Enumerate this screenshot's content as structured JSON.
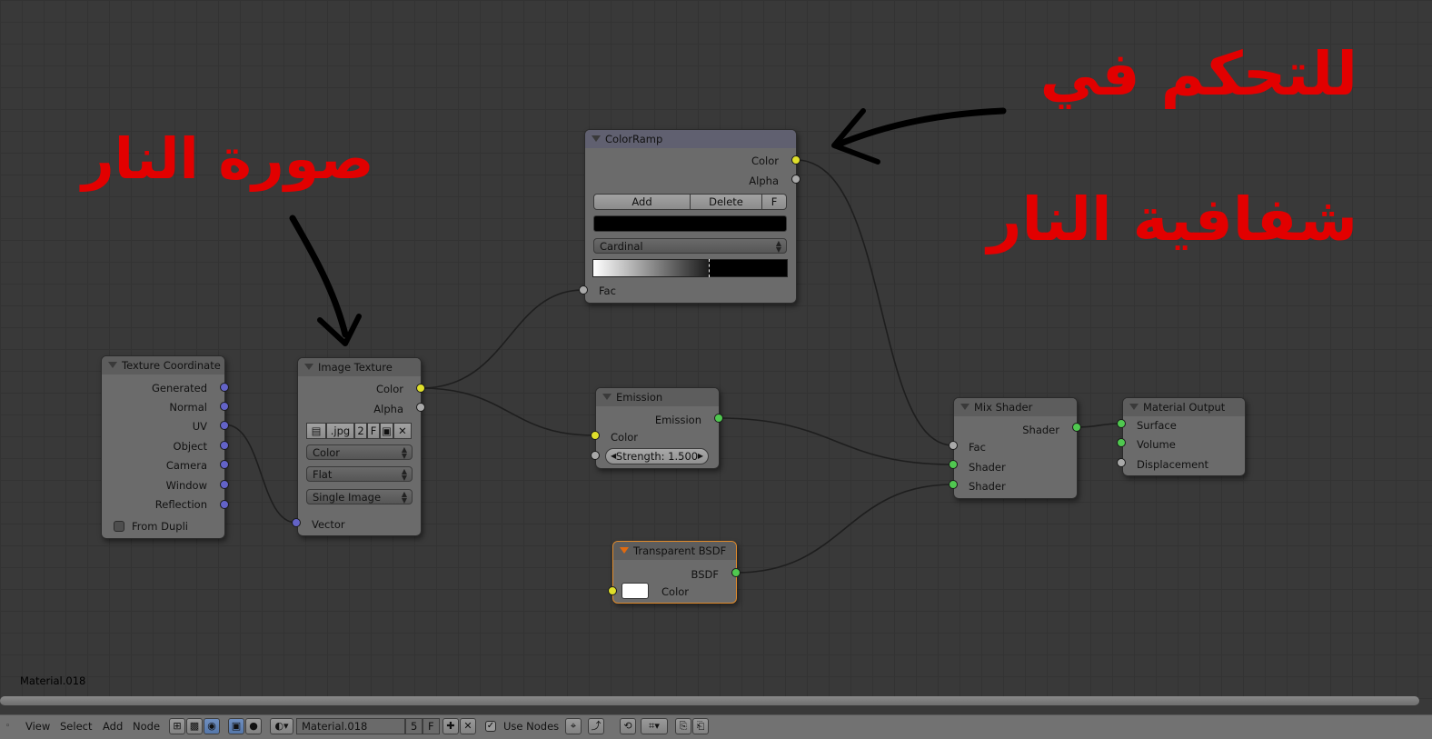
{
  "annotations": {
    "top_right_line1": "للتحكم في",
    "top_right_line2": "شفافية النار",
    "left": "صورة النار"
  },
  "footer_material_label": "Material.018",
  "nodes": {
    "texture_coordinate": {
      "title": "Texture Coordinate",
      "outputs": [
        "Generated",
        "Normal",
        "UV",
        "Object",
        "Camera",
        "Window",
        "Reflection"
      ],
      "checkbox_label": "From Dupli"
    },
    "image_texture": {
      "title": "Image Texture",
      "outputs": [
        "Color",
        "Alpha"
      ],
      "image_name": ".jpg",
      "users_count": "2",
      "fake_user": "F",
      "color_space": "Color",
      "projection": "Flat",
      "source": "Single Image",
      "input": "Vector"
    },
    "color_ramp": {
      "title": "ColorRamp",
      "outputs": [
        "Color",
        "Alpha"
      ],
      "add_label": "Add",
      "delete_label": "Delete",
      "f_label": "F",
      "interpolation": "Cardinal",
      "input": "Fac"
    },
    "emission": {
      "title": "Emission",
      "output": "Emission",
      "input_color": "Color",
      "strength": "Strength: 1.500"
    },
    "transparent_bsdf": {
      "title": "Transparent BSDF",
      "output": "BSDF",
      "input_color": "Color"
    },
    "mix_shader": {
      "title": "Mix Shader",
      "output": "Shader",
      "inputs": [
        "Fac",
        "Shader",
        "Shader"
      ]
    },
    "material_output": {
      "title": "Material Output",
      "inputs": [
        "Surface",
        "Volume",
        "Displacement"
      ]
    }
  },
  "toolbar": {
    "menu": [
      "View",
      "Select",
      "Add",
      "Node"
    ],
    "material_name": "Material.018",
    "users": "5",
    "fake_user": "F",
    "use_nodes_label": "Use Nodes",
    "use_nodes_checked": true
  },
  "colors": {
    "annotation": "#e20000",
    "socket_color": "#dfdf2b",
    "socket_shader": "#50c850",
    "socket_vector": "#6363c7",
    "socket_value": "#a9a9a9",
    "active_node_border": "#e08a2a"
  }
}
